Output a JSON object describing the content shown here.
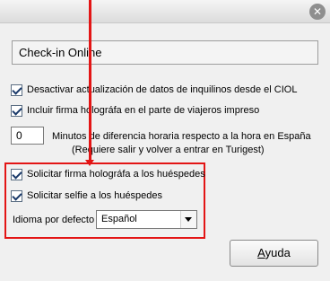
{
  "window": {
    "close_glyph": "✕"
  },
  "header": {
    "title": "Check-in Online"
  },
  "options": [
    {
      "label": "Desactivar actualización de datos de inquilinos desde el CIOL",
      "checked": true
    },
    {
      "label": "Incluir firma holográfa en el parte de viajeros impreso",
      "checked": true
    }
  ],
  "minutes": {
    "value": "0",
    "line1": "Minutos de diferencia horaria respecto a la hora en España",
    "line2": "(Requiere salir y volver a entrar en Turigest)"
  },
  "guest_options": [
    {
      "label": "Solicitar firma holográfa a los huéspedes",
      "checked": true
    },
    {
      "label": "Solicitar selfie a los huéspedes",
      "checked": true
    }
  ],
  "language": {
    "label": "Idioma por defecto",
    "selected": "Español"
  },
  "help_button": {
    "accel": "A",
    "rest": "yuda"
  },
  "colors": {
    "highlight": "#e31515",
    "checkbox_border": "#5a6d82"
  }
}
